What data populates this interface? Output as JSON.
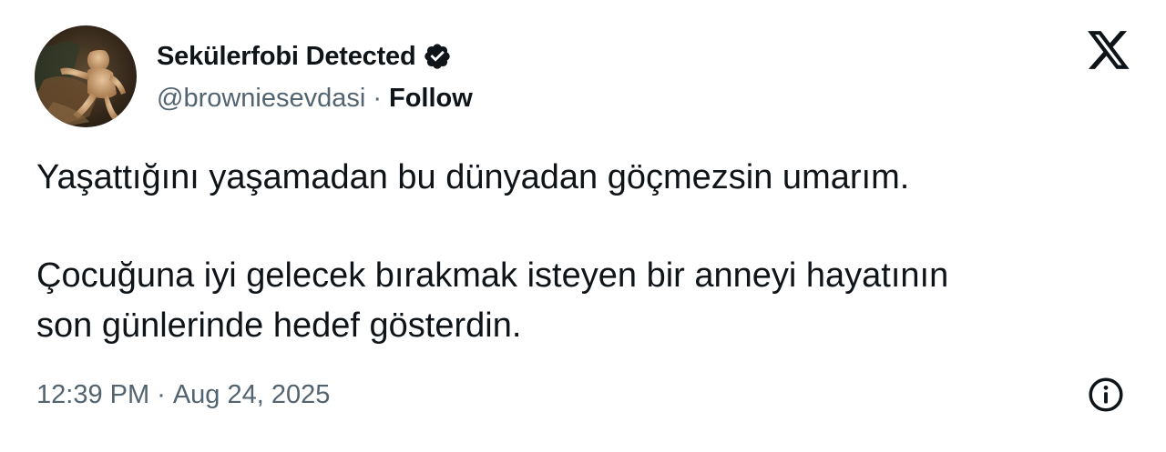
{
  "author": {
    "display_name": "Sekülerfobi Detected",
    "handle": "@browniesevdasi",
    "separator": "·",
    "follow_label": "Follow",
    "verified_icon": "verified-badge-icon",
    "avatar_icon": "profile-avatar-painting"
  },
  "header": {
    "platform_icon": "x-logo-icon"
  },
  "tweet": {
    "lines": [
      "Yaşattığını yaşamadan bu dünyadan göçmezsin umarım.",
      "Çocuğuna iyi gelecek bırakmak isteyen bir anneyi hayatının",
      "son günlerinde hedef gösterdin."
    ]
  },
  "footer": {
    "time": "12:39 PM",
    "separator": "·",
    "date": "Aug 24, 2025",
    "info_icon": "info-icon"
  },
  "colors": {
    "text_primary": "#0f1419",
    "text_secondary": "#536471",
    "background": "#ffffff"
  }
}
